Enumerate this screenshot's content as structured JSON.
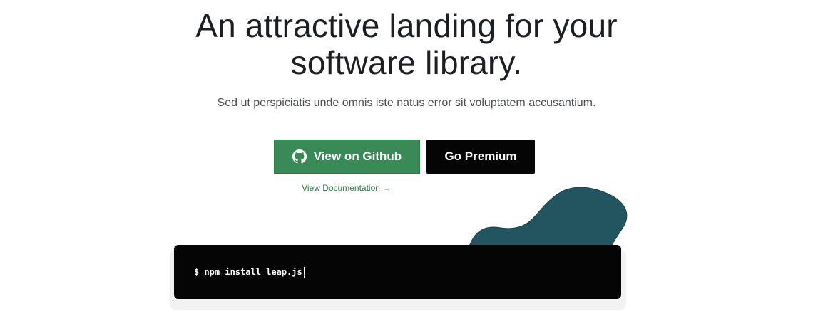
{
  "hero": {
    "title_line1": "An attractive landing for your",
    "title_line2": "software library.",
    "subtitle": "Sed ut perspiciatis unde omnis iste natus error sit voluptatem accusantium."
  },
  "actions": {
    "github_label": "View on Github",
    "github_icon": "github-icon",
    "premium_label": "Go Premium",
    "docs_label": "View Documentation",
    "docs_arrow": "→"
  },
  "terminal": {
    "command": "$ npm install leap.js"
  },
  "colors": {
    "primary_green": "#3a8a58",
    "link_green": "#2f7a4b",
    "blob_teal": "#235560",
    "terminal_bg": "#050505",
    "heading": "#1b1e22"
  }
}
